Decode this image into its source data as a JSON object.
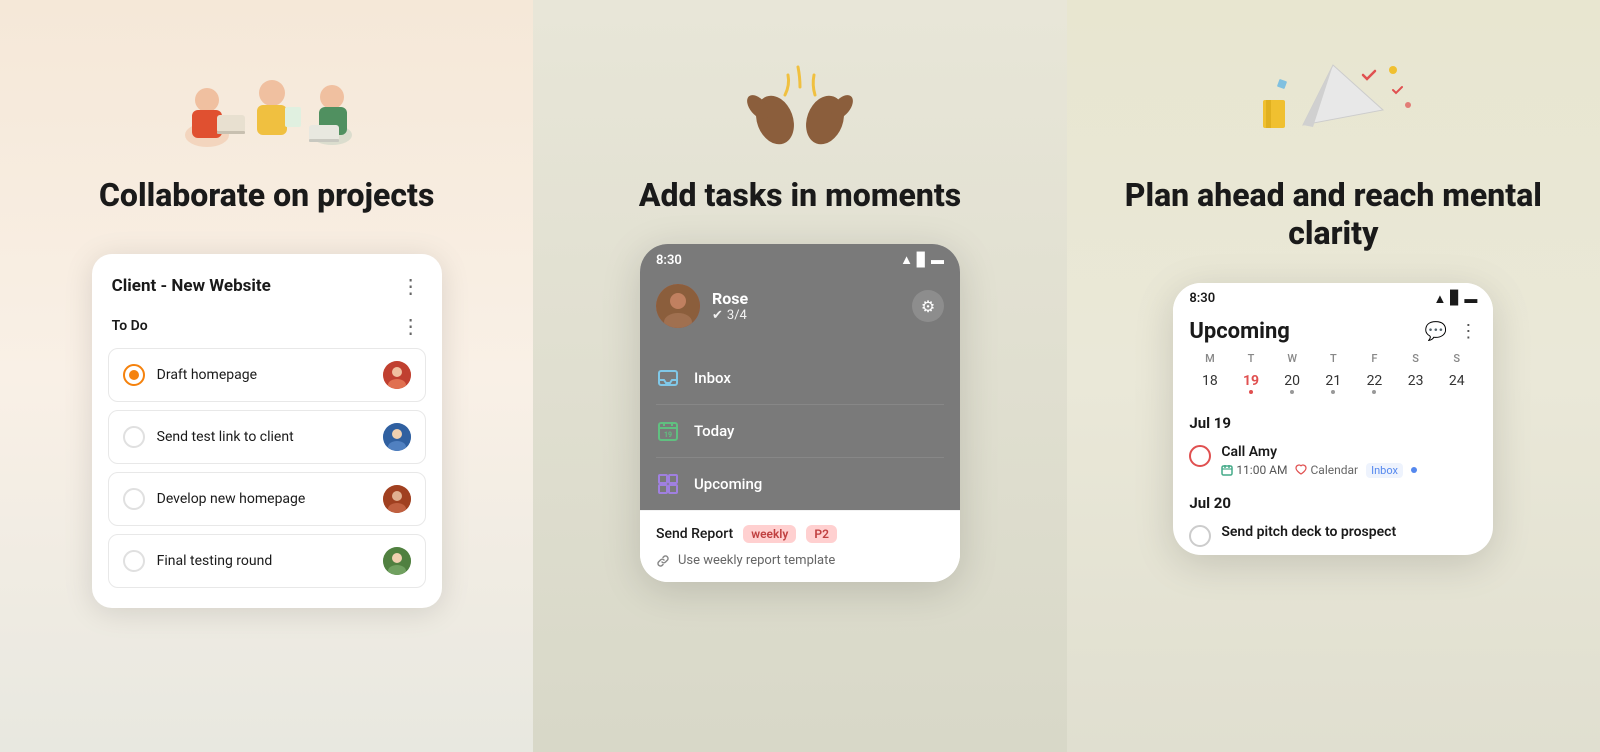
{
  "panels": [
    {
      "id": "panel-1",
      "title": "Collaborate on\nprojects",
      "card": {
        "title": "Client - New Website",
        "section": "To Do",
        "tasks": [
          {
            "text": "Draft homepage",
            "circle_style": "orange",
            "avatar": "av1"
          },
          {
            "text": "Send test link to client",
            "circle_style": "empty",
            "avatar": "av2"
          },
          {
            "text": "Develop new homepage",
            "circle_style": "empty",
            "avatar": "av3"
          },
          {
            "text": "Final testing round",
            "circle_style": "empty",
            "avatar": "av4"
          }
        ]
      }
    },
    {
      "id": "panel-2",
      "title": "Add tasks in\nmoments",
      "phone": {
        "status_time": "8:30",
        "user_name": "Rose",
        "user_tasks": "3/4",
        "nav_items": [
          {
            "label": "Inbox",
            "icon": "inbox"
          },
          {
            "label": "Today",
            "icon": "today"
          },
          {
            "label": "Upcoming",
            "icon": "upcoming"
          }
        ],
        "quick_task": "Send Report",
        "tag_weekly": "weekly",
        "tag_p2": "P2",
        "subtask": "Use weekly report template"
      }
    },
    {
      "id": "panel-3",
      "title": "Plan ahead and reach\nmental clarity",
      "phone": {
        "status_time": "8:30",
        "view_title": "Upcoming",
        "days": [
          "M",
          "T",
          "W",
          "T",
          "F",
          "S",
          "S"
        ],
        "dates": [
          {
            "num": "18",
            "style": "normal"
          },
          {
            "num": "19",
            "style": "today"
          },
          {
            "num": "20",
            "style": "dot"
          },
          {
            "num": "21",
            "style": "dot"
          },
          {
            "num": "22",
            "style": "dot"
          },
          {
            "num": "23",
            "style": "normal"
          },
          {
            "num": "24",
            "style": "normal"
          }
        ],
        "sections": [
          {
            "date_label": "Jul 19",
            "events": [
              {
                "title": "Call Amy",
                "time": "11:00 AM",
                "calendar": "Calendar",
                "inbox_label": "Inbox",
                "circle": "red"
              }
            ]
          },
          {
            "date_label": "Jul 20",
            "events": [
              {
                "title": "Send pitch deck to prospect",
                "circle": "empty"
              }
            ]
          }
        ]
      }
    }
  ]
}
